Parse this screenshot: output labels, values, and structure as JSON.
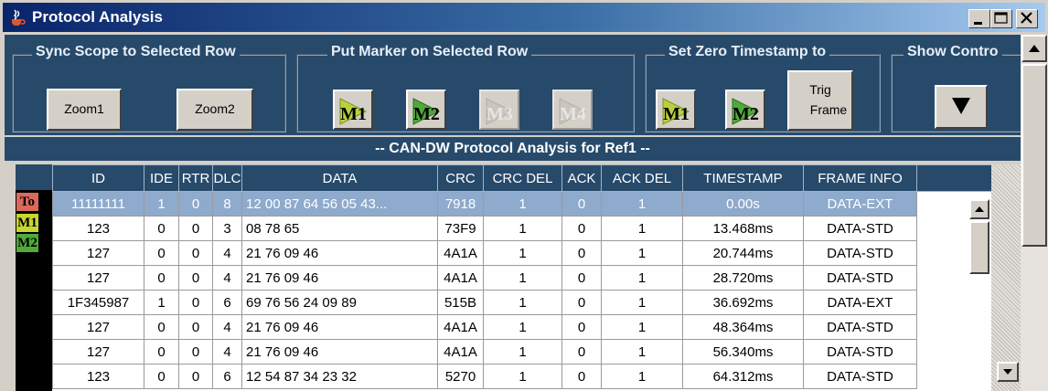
{
  "window": {
    "title": "Protocol Analysis",
    "controls": [
      "minimize-icon",
      "maximize-icon",
      "close-icon"
    ]
  },
  "toolbar": {
    "sync_group": {
      "title": "Sync Scope to Selected Row",
      "zoom1_label": "Zoom1",
      "zoom2_label": "Zoom2"
    },
    "marker_group": {
      "title": "Put Marker on Selected Row",
      "buttons": [
        {
          "label": "M1",
          "enabled": true,
          "color": "#b8d23c"
        },
        {
          "label": "M2",
          "enabled": true,
          "color": "#4faa3a"
        },
        {
          "label": "M3",
          "enabled": false
        },
        {
          "label": "M4",
          "enabled": false
        }
      ]
    },
    "zero_group": {
      "title": "Set Zero Timestamp to",
      "m1_label": "M1",
      "m2_label": "M2",
      "trig_line1": "Trig",
      "trig_line2": "Frame"
    },
    "show_group": {
      "title": "Show Contro",
      "icon": "triangle-down-icon"
    }
  },
  "caption": "-- CAN-DW Protocol Analysis for Ref1 --",
  "markers": [
    {
      "label": "To",
      "color": "#d96a5a"
    },
    {
      "label": "M1",
      "color": "#c7d630"
    },
    {
      "label": "M2",
      "color": "#4faa3a"
    }
  ],
  "table": {
    "columns": [
      "ID",
      "IDE",
      "RTR",
      "DLC",
      "DATA",
      "CRC",
      "CRC DEL",
      "ACK",
      "ACK DEL",
      "TIMESTAMP",
      "FRAME INFO"
    ],
    "rows": [
      {
        "id": "11111111",
        "ide": "1",
        "rtr": "0",
        "dlc": "8",
        "data": "12 00 87 64 56 05 43...",
        "crc": "7918",
        "crc_del": "1",
        "ack": "0",
        "ack_del": "1",
        "timestamp": "0.00s",
        "frame": "DATA-EXT",
        "selected": true
      },
      {
        "id": "123",
        "ide": "0",
        "rtr": "0",
        "dlc": "3",
        "data": "08 78 65",
        "crc": "73F9",
        "crc_del": "1",
        "ack": "0",
        "ack_del": "1",
        "timestamp": "13.468ms",
        "frame": "DATA-STD"
      },
      {
        "id": "127",
        "ide": "0",
        "rtr": "0",
        "dlc": "4",
        "data": "21 76 09 46",
        "crc": "4A1A",
        "crc_del": "1",
        "ack": "0",
        "ack_del": "1",
        "timestamp": "20.744ms",
        "frame": "DATA-STD"
      },
      {
        "id": "127",
        "ide": "0",
        "rtr": "0",
        "dlc": "4",
        "data": "21 76 09 46",
        "crc": "4A1A",
        "crc_del": "1",
        "ack": "0",
        "ack_del": "1",
        "timestamp": "28.720ms",
        "frame": "DATA-STD"
      },
      {
        "id": "1F345987",
        "ide": "1",
        "rtr": "0",
        "dlc": "6",
        "data": "69 76 56 24 09 89",
        "crc": "515B",
        "crc_del": "1",
        "ack": "0",
        "ack_del": "1",
        "timestamp": "36.692ms",
        "frame": "DATA-EXT"
      },
      {
        "id": "127",
        "ide": "0",
        "rtr": "0",
        "dlc": "4",
        "data": "21 76 09 46",
        "crc": "4A1A",
        "crc_del": "1",
        "ack": "0",
        "ack_del": "1",
        "timestamp": "48.364ms",
        "frame": "DATA-STD"
      },
      {
        "id": "127",
        "ide": "0",
        "rtr": "0",
        "dlc": "4",
        "data": "21 76 09 46",
        "crc": "4A1A",
        "crc_del": "1",
        "ack": "0",
        "ack_del": "1",
        "timestamp": "56.340ms",
        "frame": "DATA-STD"
      },
      {
        "id": "123",
        "ide": "0",
        "rtr": "0",
        "dlc": "6",
        "data": "12 54 87 34 23 32",
        "crc": "5270",
        "crc_del": "1",
        "ack": "0",
        "ack_del": "1",
        "timestamp": "64.312ms",
        "frame": "DATA-STD"
      }
    ]
  },
  "colors": {
    "panel": "#274a6b",
    "selected_row": "#8eaacc",
    "title_start": "#0a246a"
  }
}
